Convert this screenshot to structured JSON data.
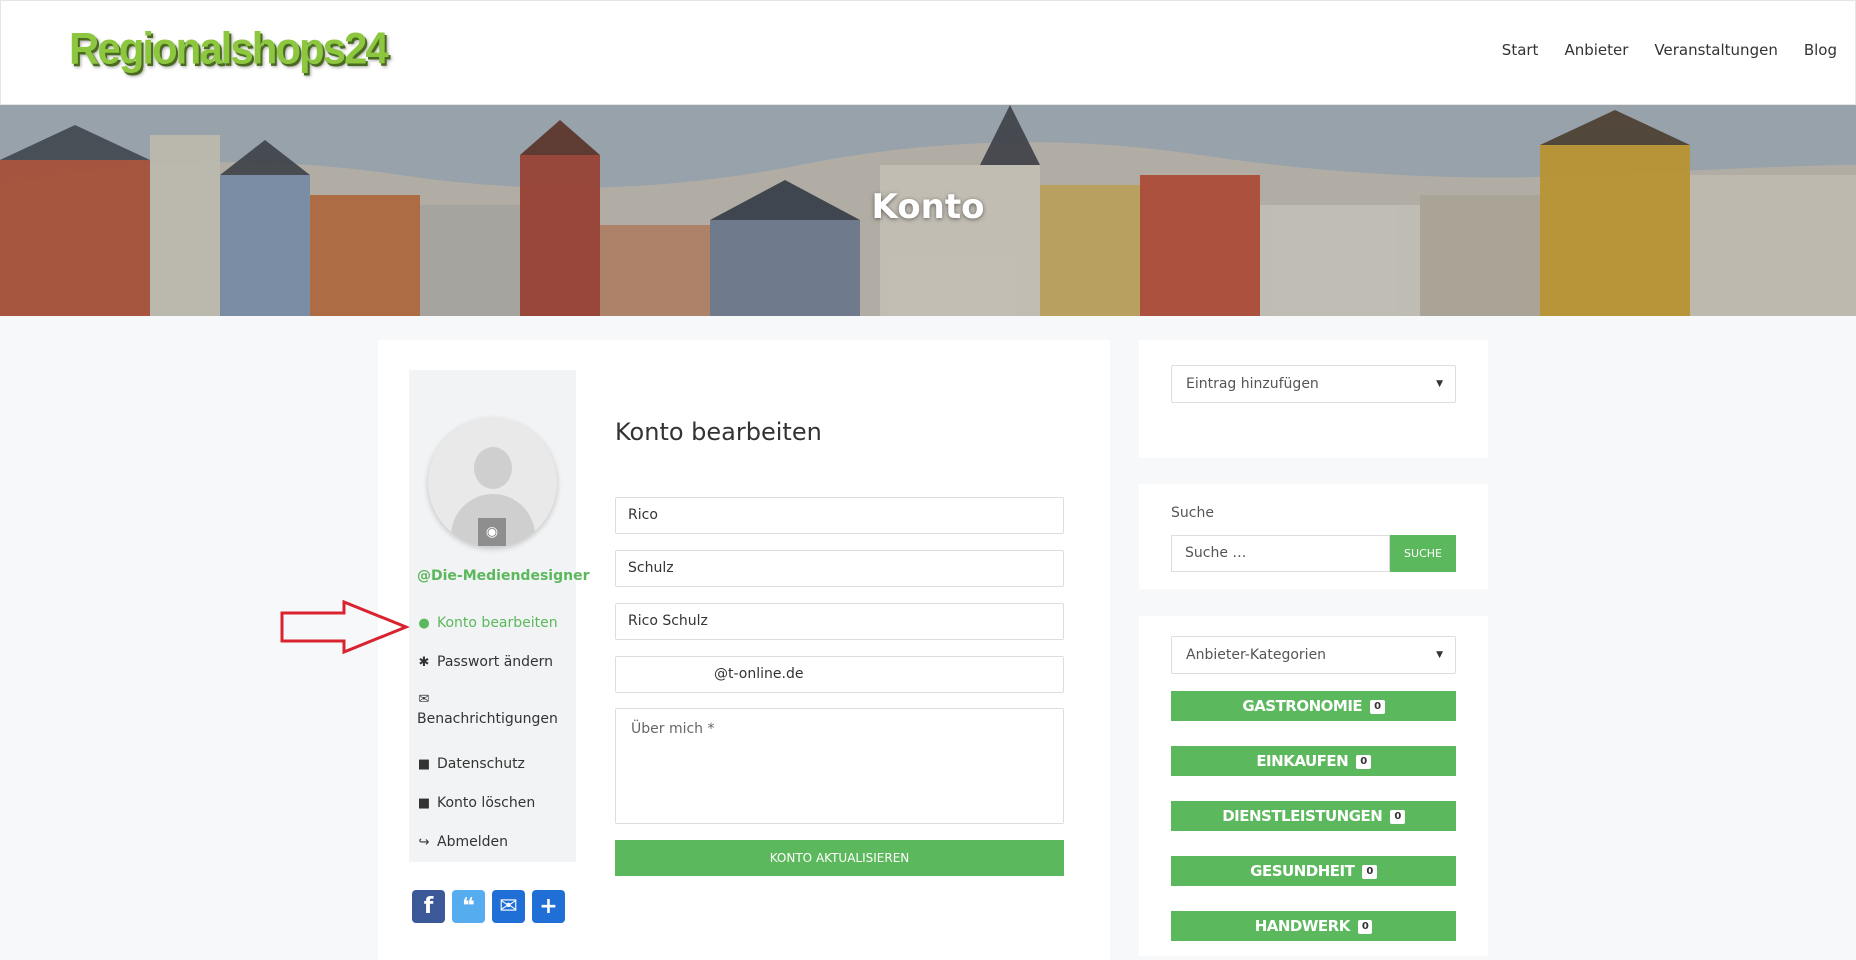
{
  "header": {
    "logo": "Regionalshops24",
    "nav": [
      "Start",
      "Anbieter",
      "Veranstaltungen",
      "Blog"
    ]
  },
  "hero": {
    "title": "Konto"
  },
  "profile": {
    "username": "@Die-Mediendesigner",
    "menu": [
      {
        "label": "Konto bearbeiten",
        "icon": "user-icon"
      },
      {
        "label": "Passwort ändern",
        "icon": "asterisk-icon"
      },
      {
        "label": "Benachrichtigungen",
        "icon": "envelope-icon"
      },
      {
        "label": "Datenschutz",
        "icon": "lock-icon"
      },
      {
        "label": "Konto löschen",
        "icon": "lock-icon"
      },
      {
        "label": "Abmelden",
        "icon": "sign-out-icon"
      }
    ],
    "social": [
      "facebook-icon",
      "twitter-icon",
      "email-icon",
      "share-icon"
    ]
  },
  "form": {
    "title": "Konto bearbeiten",
    "first_name": "Rico",
    "last_name": "Schulz",
    "display_name": "Rico Schulz",
    "email": "@t-online.de",
    "about_placeholder": "Über mich *",
    "submit": "KONTO AKTUALISIEREN"
  },
  "sidebar": {
    "add_entry": "Eintrag hinzufügen",
    "search_label": "Suche",
    "search_placeholder": "Suche …",
    "search_button": "SUCHE",
    "categories_select": "Anbieter-Kategorien",
    "categories": [
      {
        "label": "GASTRONOMIE",
        "count": "0"
      },
      {
        "label": "EINKAUFEN",
        "count": "0"
      },
      {
        "label": "DIENSTLEISTUNGEN",
        "count": "0"
      },
      {
        "label": "GESUNDHEIT",
        "count": "0"
      },
      {
        "label": "HANDWERK",
        "count": "0"
      }
    ]
  },
  "colors": {
    "accent": "#5cb85c",
    "arrow": "#d9232e",
    "logo": "#8dc63f"
  }
}
